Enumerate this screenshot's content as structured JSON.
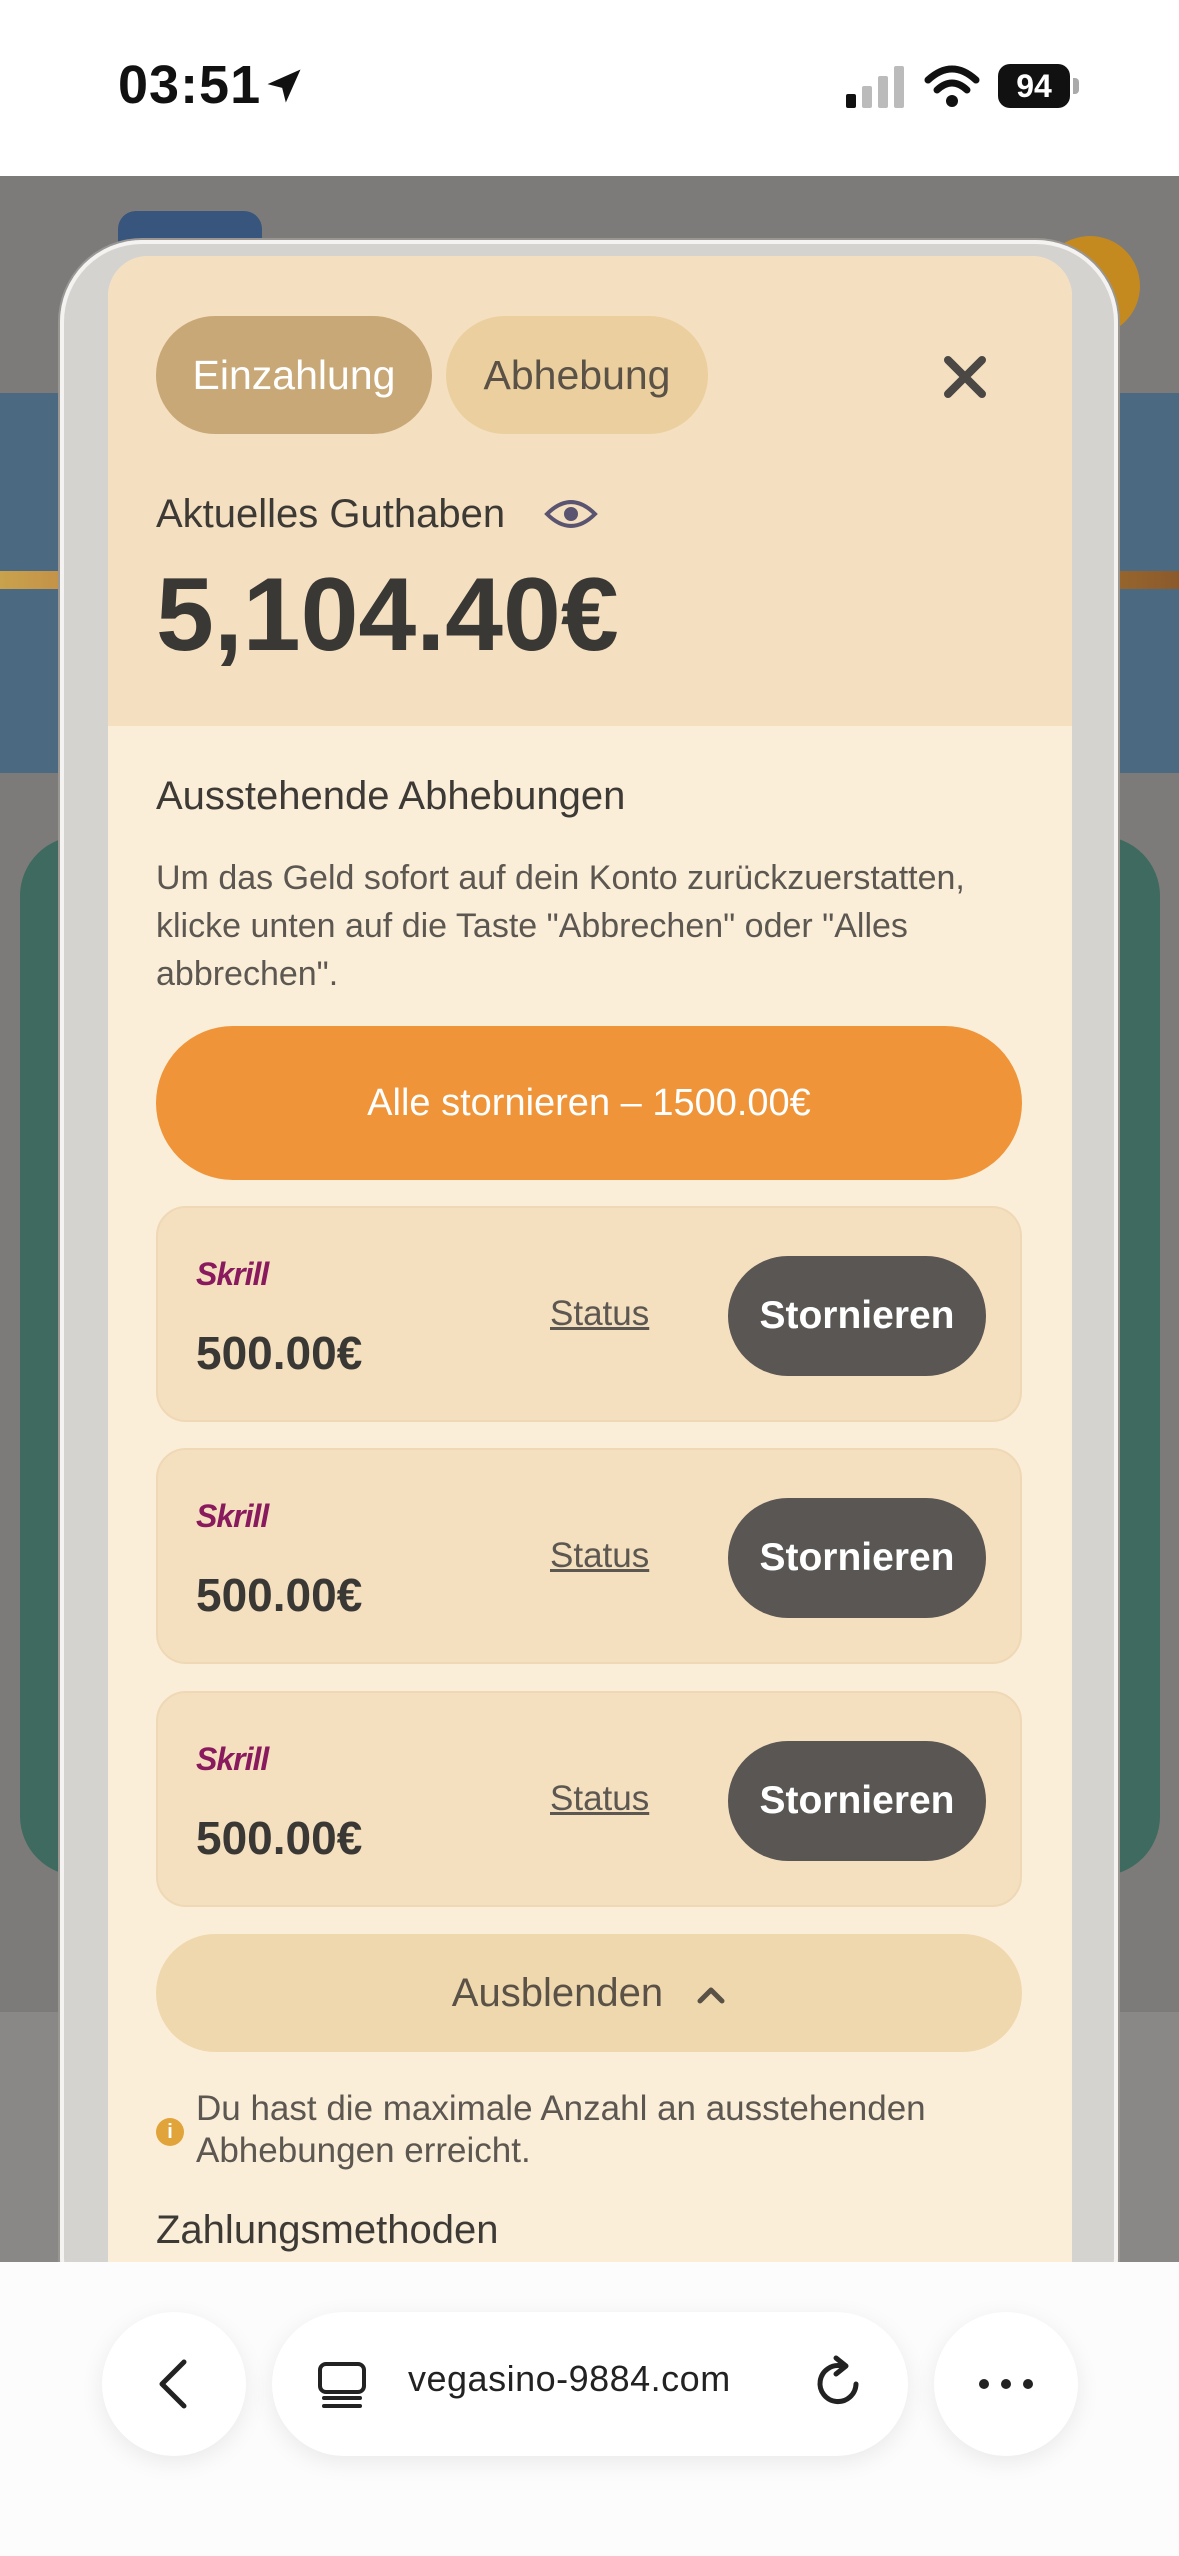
{
  "status_bar": {
    "time": "03:51",
    "battery": "94"
  },
  "modal": {
    "tabs": {
      "deposit": "Einzahlung",
      "withdraw": "Abhebung"
    },
    "balance_label": "Aktuelles Guthaben",
    "balance_value": "5,104.40€",
    "pending_title": "Ausstehende Abhebungen",
    "pending_desc": "Um das Geld sofort auf dein Konto zurückzuerstatten, klicke unten auf die Taste \"Abbrechen\" oder \"Alles abbrechen\".",
    "cancel_all": "Alle stornieren – 1500.00€",
    "withdrawals": [
      {
        "provider": "Skrill",
        "amount": "500.00€",
        "status_label": "Status",
        "cancel_label": "Stornieren"
      },
      {
        "provider": "Skrill",
        "amount": "500.00€",
        "status_label": "Status",
        "cancel_label": "Stornieren"
      },
      {
        "provider": "Skrill",
        "amount": "500.00€",
        "status_label": "Status",
        "cancel_label": "Stornieren"
      }
    ],
    "hide_label": "Ausblenden",
    "info_text": "Du hast die maximale Anzahl an ausstehenden Abhebungen erreicht.",
    "payment_methods_title": "Zahlungsmethoden"
  },
  "browser": {
    "url": "vegasino-9884.com"
  },
  "colors": {
    "accent_orange": "#ef9438",
    "tab_active": "#c9a878",
    "cancel_button": "#595654",
    "skrill_brand": "#8a1a5e"
  }
}
